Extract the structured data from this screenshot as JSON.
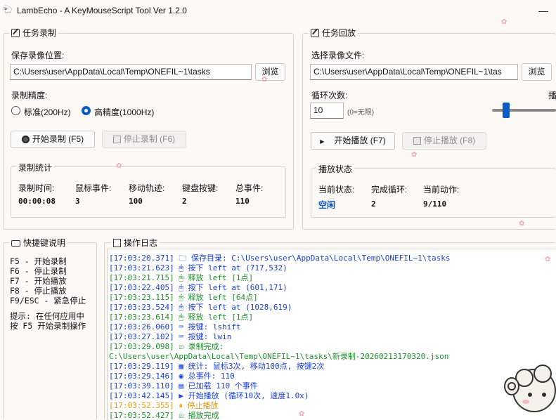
{
  "window": {
    "title": "LambEcho - A KeyMouseScript Tool Ver 1.2.0",
    "icon": "lamb-icon",
    "controls": {
      "minimize": "—",
      "maximize": "☐"
    }
  },
  "record": {
    "group_title": "任务录制",
    "save_location_label": "保存录像位置:",
    "save_path": "C:\\Users\\user\\AppData\\Local\\Temp\\ONEFIL~1\\tasks",
    "browse_label": "浏览",
    "precision_label": "录制精度:",
    "precision_options": [
      "标准(200Hz)",
      "高精度(1000Hz)"
    ],
    "precision_selected": "高精度(1000Hz)",
    "start_label": "开始录制 (F5)",
    "stop_label": "停止录制 (F6)",
    "stats": {
      "title": "录制统计",
      "headers": [
        "录制时间:",
        "鼠标事件:",
        "移动轨迹:",
        "键盘按键:",
        "总事件:"
      ],
      "values": [
        "00:00:08",
        "3",
        "100",
        "2",
        "110"
      ]
    }
  },
  "playback": {
    "group_title": "任务回放",
    "file_label": "选择录像文件:",
    "file_path": "C:\\Users\\user\\AppData\\Local\\Temp\\ONEFIL~1\\tas",
    "browse_label": "浏览",
    "loop_label": "循环次数:",
    "loop_value": "10",
    "loop_hint": "(0=无限)",
    "speed_label_partial": "播",
    "start_label": "开始播放 (F7)",
    "stop_label": "停止播放 (F8)",
    "status": {
      "title": "播放状态",
      "headers": [
        "当前状态:",
        "完成循环:",
        "当前动作:"
      ],
      "values": [
        "空闲",
        "2",
        "9/110"
      ]
    }
  },
  "hotkeys": {
    "title": "快捷键说明",
    "lines": [
      "F5 - 开始录制",
      "F6 - 停止录制",
      "F7 - 开始播放",
      "F8 - 停止播放",
      "F9/ESC - 紧急停止"
    ],
    "tip_lines": [
      "提示: 在任何应用中",
      "按 F5 开始录制操作"
    ]
  },
  "log": {
    "title": "操作日志",
    "lines": [
      {
        "text": "[17:03:20.371] 🗀 保存目录: C:\\Users\\user\\AppData\\Local\\Temp\\ONEFIL~1\\tasks",
        "color": "#1a3fd6"
      },
      {
        "text": "[17:03:21.623] 🖱   按下 left at (717,532)",
        "color": "#1a3fd6"
      },
      {
        "text": "[17:03:21.715] 🖱   释放 left [1点]",
        "color": "#1f8f2a"
      },
      {
        "text": "[17:03:22.405] 🖱   按下 left at (601,171)",
        "color": "#1a3fd6"
      },
      {
        "text": "[17:03:23.115] 🖱   释放 left [64点]",
        "color": "#1f8f2a"
      },
      {
        "text": "[17:03:23.524] 🖱   按下 left at (1028,619)",
        "color": "#1a3fd6"
      },
      {
        "text": "[17:03:23.614] 🖱   释放 left [1点]",
        "color": "#1f8f2a"
      },
      {
        "text": "[17:03:26.060] ⌨ 按键: lshift",
        "color": "#1a3fd6"
      },
      {
        "text": "[17:03:27.102] ⌨ 按键: lwin",
        "color": "#1a3fd6"
      },
      {
        "text": "[17:03:29.098] ☑ 录制完成:",
        "color": "#1f8f2a"
      },
      {
        "text": "C:\\Users\\user\\AppData\\Local\\Temp\\ONEFIL~1\\tasks\\新录制-20260213170320.json",
        "color": "#1f8f2a"
      },
      {
        "text": "[17:03:29.119] ▦ 统计: 鼠标3次, 移动100点, 按键2次",
        "color": "#1a3fd6"
      },
      {
        "text": "[17:03:29.146] ◉ 总事件: 110",
        "color": "#1a3fd6"
      },
      {
        "text": "[17:03:39.110] ▤ 已加载 110 个事件",
        "color": "#1a3fd6"
      },
      {
        "text": "[17:03:42.145] ▶ 开始播放 (循环10次, 速度1.0x)",
        "color": "#1a3fd6"
      },
      {
        "text": "[17:03:52.355] ⏸ 停止播放",
        "color": "#e59a10"
      },
      {
        "text": "[17:03:52.427] ☑ 播放完成",
        "color": "#1f8f2a"
      }
    ]
  },
  "colors": {
    "background": "#fdfaf6",
    "accent": "#0b5cc7",
    "log_info": "#1a3fd6",
    "log_success": "#1f8f2a",
    "log_warning": "#e59a10",
    "status_idle": "#0b4fc7"
  }
}
